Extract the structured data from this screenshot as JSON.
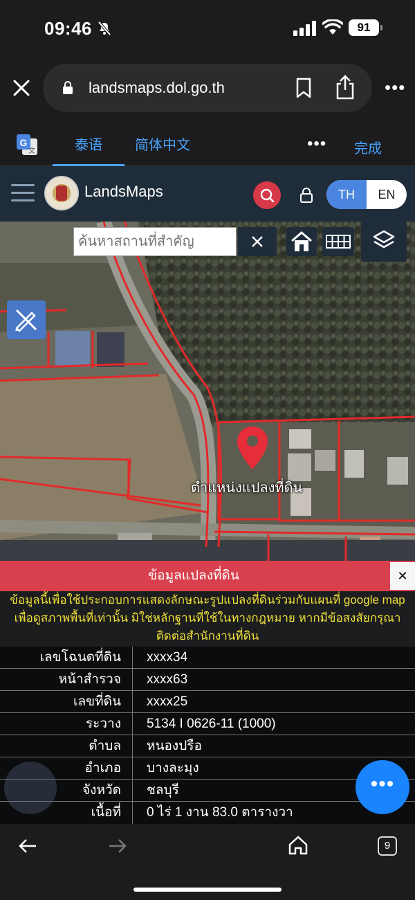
{
  "status_bar": {
    "time": "09:46",
    "battery": "91"
  },
  "browser": {
    "url": "landsmaps.dol.go.th"
  },
  "translate_bar": {
    "tab_thai": "泰语",
    "tab_chinese": "简体中文",
    "more": "•••",
    "done": "完成"
  },
  "app": {
    "brand": "LandsMaps",
    "lang_th": "TH",
    "lang_en": "EN",
    "search_placeholder": "ค้นหาสถานที่สำคัญ"
  },
  "map": {
    "pin_label": "ตำแหน่งแปลงที่ดิน"
  },
  "panel": {
    "title": "ข้อมูลแปลงที่ดิน",
    "close": "✕",
    "notice": "ข้อมูลนี้เพื่อใช้ประกอบการแสดงลักษณะรูปแปลงที่ดินร่วมกับแผนที่ google map เพื่อดูสภาพพื้นที่เท่านั้น มิใช่หลักฐานที่ใช้ในทางกฎหมาย หากมีข้อสงสัยกรุณาติดต่อสำนักงานที่ดิน",
    "rows": [
      {
        "label": "เลขโฉนดที่ดิน",
        "value": "xxxx34"
      },
      {
        "label": "หน้าสำรวจ",
        "value": "xxxx63"
      },
      {
        "label": "เลขที่ดิน",
        "value": "xxxx25"
      },
      {
        "label": "ระวาง",
        "value": "5134 I 0626-11 (1000)"
      },
      {
        "label": "ตำบล",
        "value": "หนองปรือ"
      },
      {
        "label": "อำเภอ",
        "value": "บางละมุง"
      },
      {
        "label": "จังหวัด",
        "value": "ชลบุรี"
      },
      {
        "label": "เนื้อที่",
        "value": "0 ไร่ 1 งาน 83.0 ตารางวา"
      }
    ]
  },
  "fab_label": "•••",
  "tab_count": "9",
  "colors": {
    "accent_red": "#d9404e",
    "accent_blue": "#1a84ff",
    "header_bg": "#1f2c3a",
    "notice_text": "#f0e03a"
  }
}
